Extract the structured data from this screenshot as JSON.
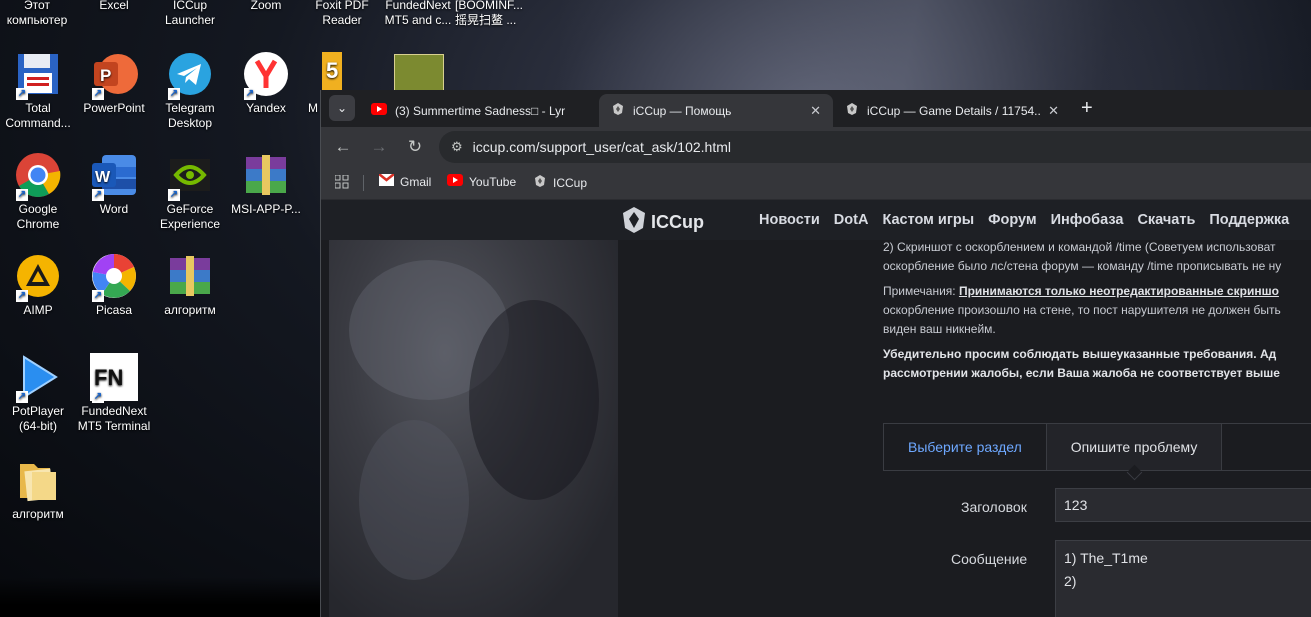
{
  "desktop": {
    "top_labels": [
      {
        "text": "Этот\nкомпьютер"
      },
      {
        "text": "Excel"
      },
      {
        "text": "ICCup\nLauncher"
      },
      {
        "text": "Zoom"
      },
      {
        "text": "Foxit PDF\nReader"
      },
      {
        "text": "FundedNext\nMT5 and c..."
      },
      {
        "text": "[BOOMINF...\n摇晃扫鳌 ..."
      }
    ],
    "icons": [
      {
        "label": "Total\nCommand...",
        "icon": "total-commander-icon"
      },
      {
        "label": "PowerPoint",
        "icon": "powerpoint-icon"
      },
      {
        "label": "Telegram\nDesktop",
        "icon": "telegram-icon"
      },
      {
        "label": "Yandex",
        "icon": "yandex-icon"
      },
      {
        "label": "M",
        "icon": "mt5-icon"
      },
      {
        "label": "Google\nChrome",
        "icon": "chrome-icon"
      },
      {
        "label": "Word",
        "icon": "word-icon"
      },
      {
        "label": "GeForce\nExperience",
        "icon": "geforce-icon"
      },
      {
        "label": "MSI-APP-P...",
        "icon": "winrar-icon"
      },
      {
        "label": "AIMP",
        "icon": "aimp-icon"
      },
      {
        "label": "Picasa",
        "icon": "picasa-icon"
      },
      {
        "label": "алгоритм",
        "icon": "winrar-icon"
      },
      {
        "label": "PotPlayer\n(64-bit)",
        "icon": "potplayer-icon"
      },
      {
        "label": "FundedNext\nMT5 Terminal",
        "icon": "fundednext-icon"
      },
      {
        "label": "алгоритм",
        "icon": "folder-icon"
      }
    ]
  },
  "browser": {
    "tabs": [
      {
        "title": "(3) Summertime Sadness□ - Lyr",
        "icon": "youtube-icon"
      },
      {
        "title": "iCCup — Помощь",
        "icon": "iccup-icon"
      },
      {
        "title": "iCCup — Game Details / 11754...",
        "icon": "iccup-icon"
      }
    ],
    "new_tab": "+",
    "url": "iccup.com/support_user/cat_ask/102.html",
    "bookmarks": [
      {
        "label": "Gmail",
        "icon": "gmail-icon"
      },
      {
        "label": "YouTube",
        "icon": "youtube-icon"
      },
      {
        "label": "ICCup",
        "icon": "iccup-icon"
      }
    ]
  },
  "site": {
    "logo": "ICCup",
    "nav": [
      "Новости",
      "DotA",
      "Кастом игры",
      "Форум",
      "Инфобаза",
      "Скачать",
      "Поддержка"
    ],
    "text_line1": "2) Скриншот с оскорблением и командой /time (Советуем использоват",
    "text_line2": "оскорбление было лс/стена форум — команду /time прописывать не ну",
    "note_prefix": "Примечания: ",
    "note_bold": "Принимаются только неотредактированные скриншо",
    "note_line2": "оскорбление произошло на стене, то пост нарушителя не должен быть",
    "note_line3": "виден ваш никнейм.",
    "warning_line1": "Убедительно просим соблюдать вышеуказанные требования. Ад",
    "warning_line2": "рассмотрении жалобы, если Ваша жалоба не соответствует выше",
    "tab_choose": "Выберите раздел",
    "tab_describe": "Опишите проблему",
    "title_label": "Заголовок",
    "title_value": "123",
    "message_label": "Сообщение",
    "message_line1": "1) The_T1me",
    "message_line2": "2)"
  },
  "colors": {
    "accent_link": "#6ea8ff",
    "tab_active": "#35363a",
    "page_bg": "#1b1c20"
  }
}
